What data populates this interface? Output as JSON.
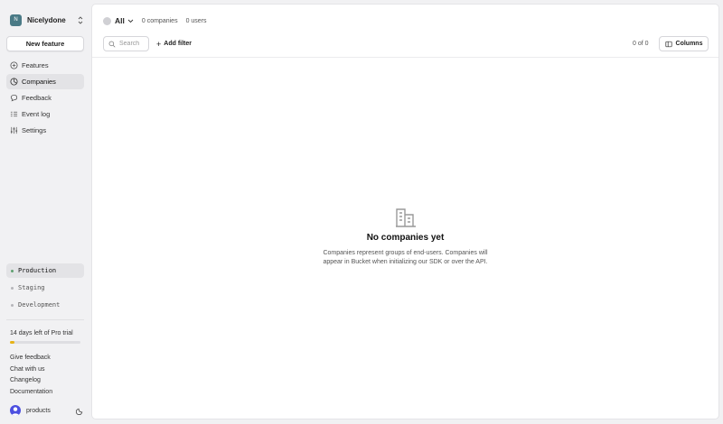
{
  "org": {
    "initial": "N",
    "name": "Nicelydone"
  },
  "sidebar": {
    "new_feature_label": "New feature",
    "nav": [
      {
        "label": "Features",
        "icon": "features-icon"
      },
      {
        "label": "Companies",
        "icon": "companies-icon",
        "active": true
      },
      {
        "label": "Feedback",
        "icon": "feedback-icon"
      },
      {
        "label": "Event log",
        "icon": "event-log-icon"
      },
      {
        "label": "Settings",
        "icon": "settings-icon"
      }
    ],
    "environments": [
      {
        "label": "Production",
        "active": true
      },
      {
        "label": "Staging"
      },
      {
        "label": "Development"
      }
    ],
    "trial_text": "14 days left of Pro trial",
    "trial_progress": 0.07,
    "links": [
      "Give feedback",
      "Chat with us",
      "Changelog",
      "Documentation"
    ],
    "user_name": "products"
  },
  "main": {
    "filter_label": "All",
    "companies_count": "0 companies",
    "users_count": "0 users",
    "search_placeholder": "Search",
    "add_filter_label": "Add filter",
    "pager": "0 of 0",
    "columns_label": "Columns",
    "empty_title": "No companies yet",
    "empty_description": "Companies represent groups of end-users. Companies will appear in Bucket when initializing our SDK or over the API."
  },
  "colors": {
    "accent_trial": "#e6b318",
    "env_active_dot": "#5fa070",
    "org_avatar": "#4a7a86",
    "user_avatar": "#4c4fe0"
  }
}
